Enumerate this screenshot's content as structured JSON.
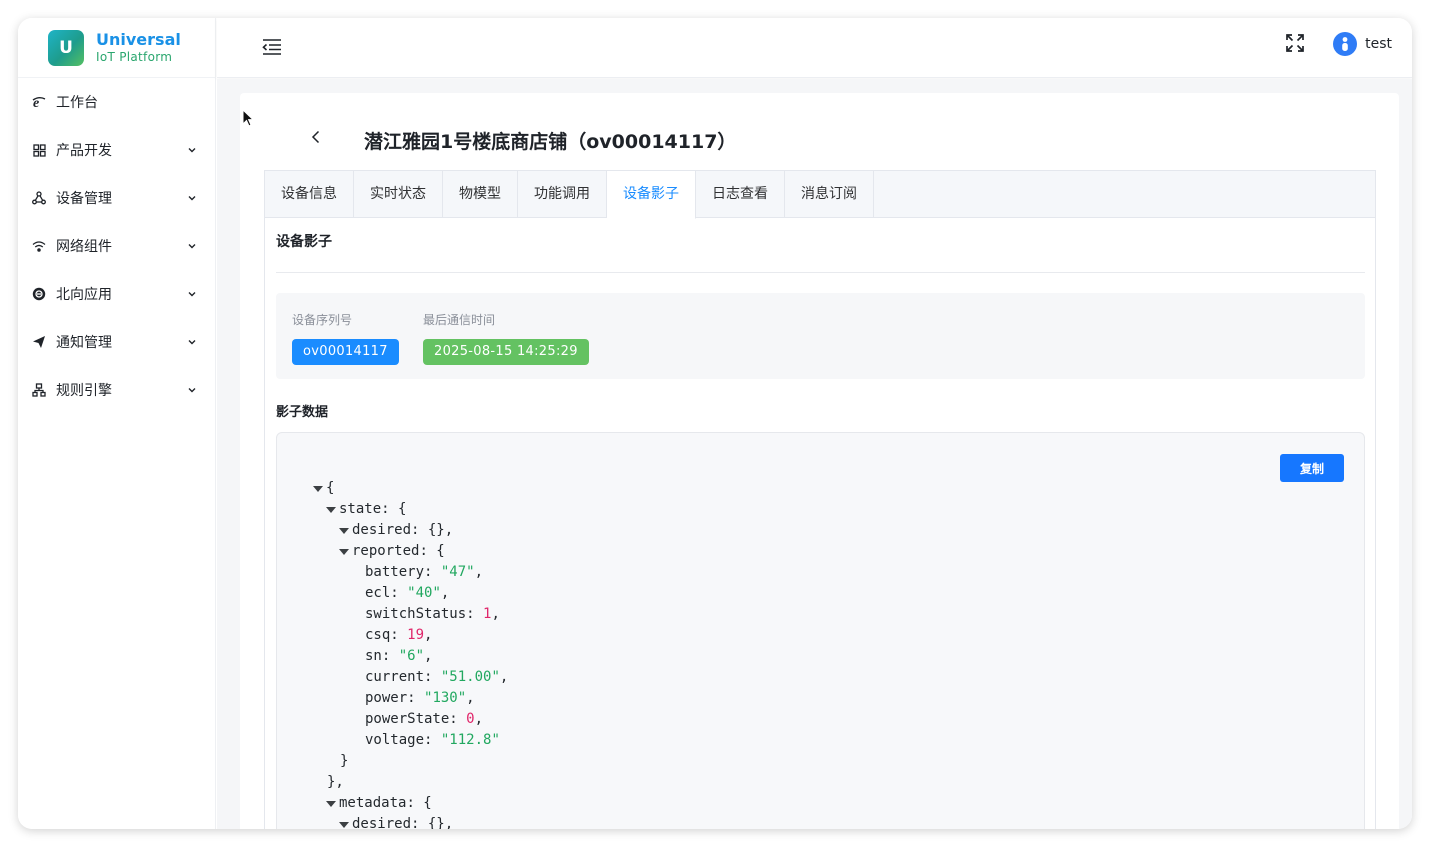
{
  "brand": {
    "logo_letter": "U",
    "title": "Universal",
    "subtitle": "IoT Platform"
  },
  "sidebar": {
    "items": [
      {
        "label": "工作台",
        "icon": "ie-icon",
        "has_children": false
      },
      {
        "label": "产品开发",
        "icon": "grid-icon",
        "has_children": true
      },
      {
        "label": "设备管理",
        "icon": "nodes-icon",
        "has_children": true
      },
      {
        "label": "网络组件",
        "icon": "wifi-icon",
        "has_children": true
      },
      {
        "label": "北向应用",
        "icon": "app-icon",
        "has_children": true
      },
      {
        "label": "通知管理",
        "icon": "send-icon",
        "has_children": true
      },
      {
        "label": "规则引擎",
        "icon": "hierarchy-icon",
        "has_children": true
      }
    ]
  },
  "header": {
    "user_name": "test"
  },
  "page": {
    "title": "潜江雅园1号楼底商店铺（ov00014117）",
    "tabs": [
      "设备信息",
      "实时状态",
      "物模型",
      "功能调用",
      "设备影子",
      "日志查看",
      "消息订阅"
    ],
    "active_tab": "设备影子",
    "section_title": "设备影子",
    "serial_label": "设备序列号",
    "serial_value": "ov00014117",
    "last_comm_label": "最后通信时间",
    "last_comm_value": "2025-08-15 14:25:29",
    "shadow_title": "影子数据",
    "copy_label": "复制"
  },
  "shadow_json": {
    "state_key": "state",
    "desired_key": "desired",
    "reported_key": "reported",
    "metadata_key": "metadata",
    "reported": [
      {
        "key": "battery",
        "value": "\"47\"",
        "type": "str"
      },
      {
        "key": "ecl",
        "value": "\"40\"",
        "type": "str"
      },
      {
        "key": "switchStatus",
        "value": "1",
        "type": "num"
      },
      {
        "key": "csq",
        "value": "19",
        "type": "num"
      },
      {
        "key": "sn",
        "value": "\"6\"",
        "type": "str"
      },
      {
        "key": "current",
        "value": "\"51.00\"",
        "type": "str"
      },
      {
        "key": "power",
        "value": "\"130\"",
        "type": "str"
      },
      {
        "key": "powerState",
        "value": "0",
        "type": "num"
      },
      {
        "key": "voltage",
        "value": "\"112.8\"",
        "type": "str"
      }
    ]
  },
  "colors": {
    "accent": "#1a8cff",
    "tag_blue": "#1a8cff",
    "tag_green": "#64c262",
    "json_string": "#22a860",
    "json_number": "#e0266a"
  }
}
